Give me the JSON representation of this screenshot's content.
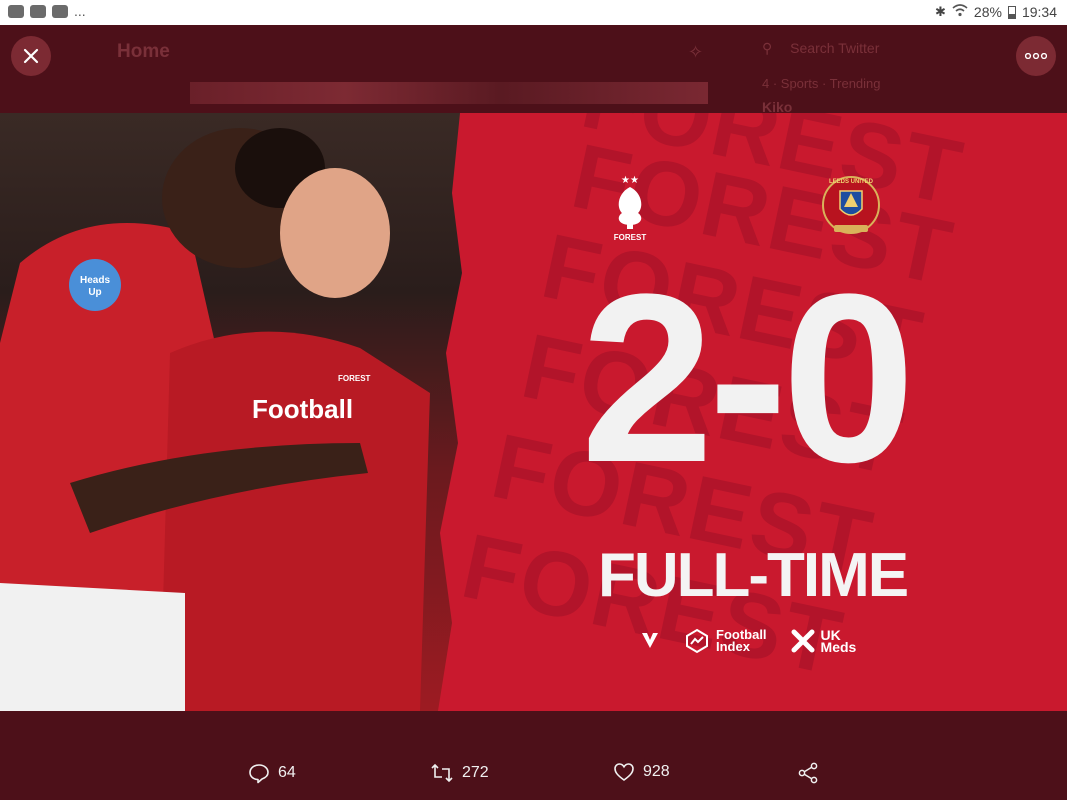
{
  "status_bar": {
    "left_icons": [
      "youtube-icon",
      "youtube-icon",
      "image-icon"
    ],
    "more": "...",
    "battery": "28%",
    "time": "19:34"
  },
  "background": {
    "home_title": "Home",
    "search_placeholder": "Search Twitter",
    "trend_line": "4 · Sports · Trending",
    "trend_name": "Kiko"
  },
  "image": {
    "score_home": "2",
    "score_away": "0",
    "score_text": "2-0",
    "status": "FULL-TIME",
    "home_crest_text": "FOREST",
    "away_crest_text": "LEEDS UNITED",
    "watermark": "FOREST",
    "shirt_sponsor": "Football",
    "sleeve_badge": "Heads Up",
    "sponsors": [
      {
        "name_line1": "Football",
        "name_line2": "Index"
      },
      {
        "name_line1": "UK",
        "name_line2": "Meds"
      }
    ],
    "colors": {
      "forest_red": "#c9192e",
      "text_white": "#f2f2f2"
    }
  },
  "actions": {
    "reply_count": "64",
    "retweet_count": "272",
    "like_count": "928"
  }
}
